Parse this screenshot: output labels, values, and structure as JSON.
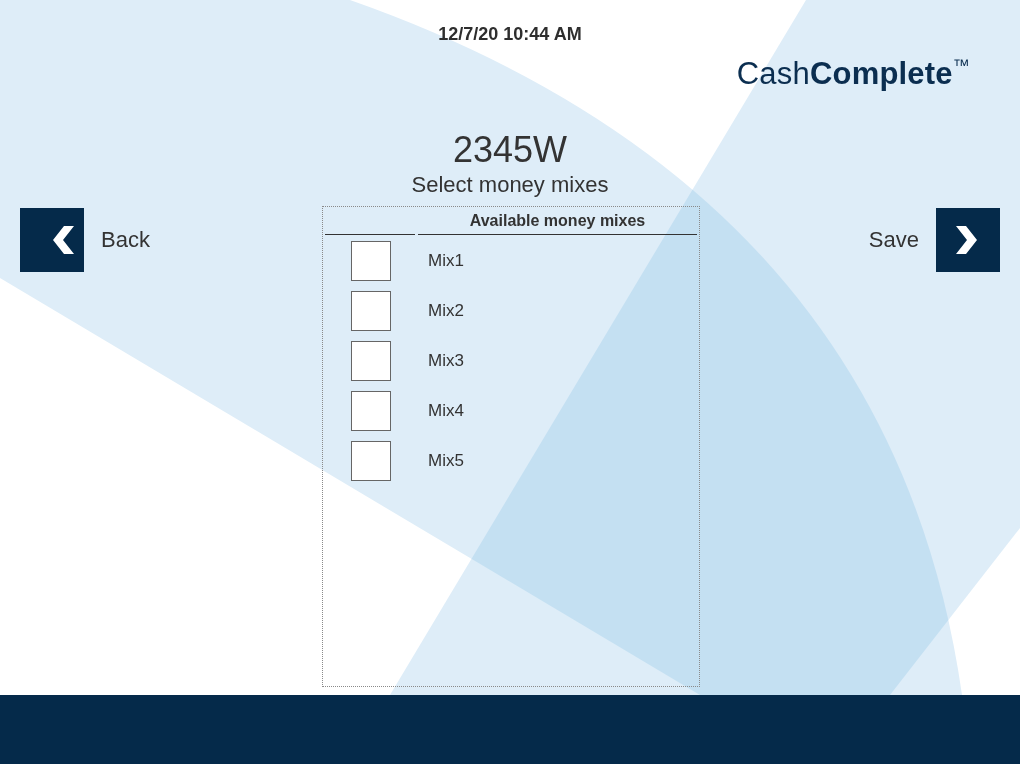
{
  "timestamp": "12/7/20 10:44 AM",
  "logo": "Cash**Complete**$^{™}$",
  "title": "2345W",
  "subtitle": "Select money mixes",
  "back_button": {
    "label": "Back"
  },
  "save_button": {
    "label": "Save"
  },
  "table": {
    "column_heading": "Available money mixes",
    "rows": [
      {
        "name": "Mix1",
        "checked": false
      },
      {
        "name": "Mix2",
        "checked": false
      },
      {
        "name": "Mix3",
        "checked": false
      },
      {
        "name": "Mix4",
        "checked": false
      },
      {
        "name": "Mix5",
        "checked": false
      }
    ]
  }
}
